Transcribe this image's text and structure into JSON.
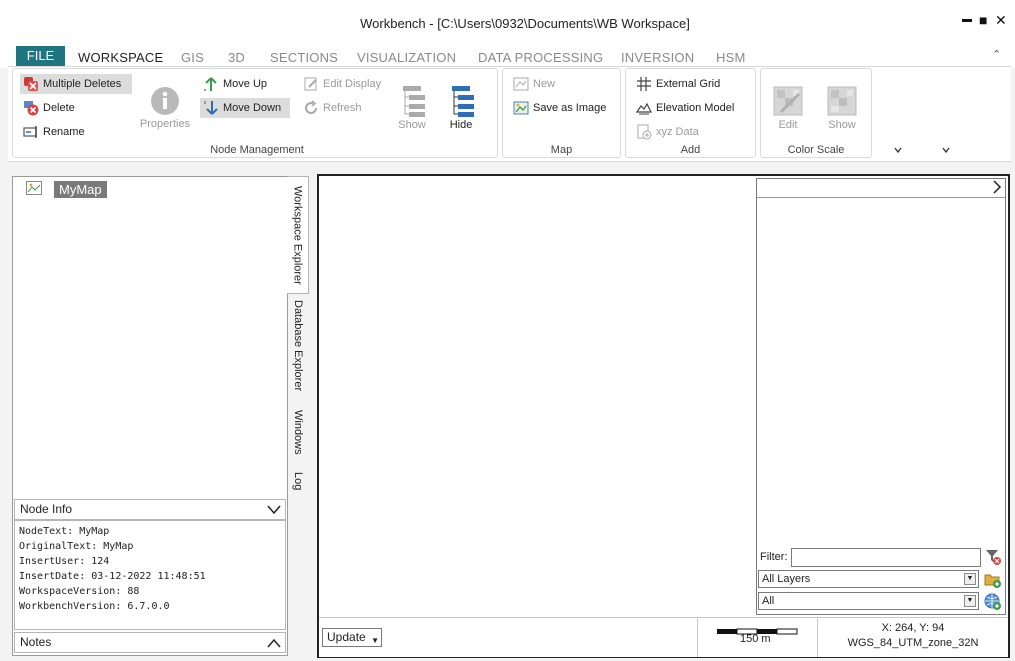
{
  "window": {
    "title": "Workbench - [C:\\Users\\0932\\Documents\\WB Workspace]"
  },
  "window_controls": {
    "minimize": "▬",
    "maximize": "■",
    "close": "✕"
  },
  "ribbon_tabs": {
    "file": "FILE",
    "workspace": "WORKSPACE",
    "gis": "GIS",
    "three_d": "3D",
    "sections": "SECTIONS",
    "visualization": "VISUALIZATION",
    "data_processing": "DATA PROCESSING",
    "inversion": "INVERSION",
    "hsm": "HSM",
    "collapse": "⌃"
  },
  "node_management": {
    "label": "Node Management",
    "multiple_deletes": "Multiple Deletes",
    "delete": "Delete",
    "rename": "Rename",
    "properties": "Properties",
    "move_up": "Move Up",
    "move_down": "Move Down",
    "edit_display": "Edit Display",
    "refresh": "Refresh",
    "show": "Show",
    "hide": "Hide"
  },
  "map_group": {
    "label": "Map",
    "new": "New",
    "save_as_image": "Save as Image"
  },
  "add_group": {
    "label": "Add",
    "external_grid": "External Grid",
    "elevation_model": "Elevation Model",
    "xyz_data": "xyz Data"
  },
  "color_scale_group": {
    "label": "Color Scale",
    "edit": "Edit",
    "show": "Show"
  },
  "tree": {
    "root_label": "MyMap"
  },
  "side_tabs": {
    "workspace_explorer": "Workspace Explorer",
    "database_explorer": "Database Explorer",
    "windows": "Windows",
    "log": "Log"
  },
  "node_info": {
    "header": "Node Info",
    "lines": [
      "NodeText:  MyMap",
      "OriginalText:  MyMap",
      "InsertUser:  124",
      "InsertDate:  03-12-2022 11:48:51",
      "WorkspaceVersion:  88",
      "WorkbenchVersion:  6.7.0.0"
    ]
  },
  "notes": {
    "header": "Notes"
  },
  "layers_panel": {
    "filter_label": "Filter:",
    "filter_value": "",
    "layer_select": "All Layers",
    "type_select": "All"
  },
  "statusbar": {
    "update": "Update",
    "scale": "150 m",
    "coords": "X: 264, Y: 94",
    "crs": "WGS_84_UTM_zone_32N"
  },
  "colors": {
    "file_tab": "#217580",
    "accent_blue": "#2f6db5",
    "green_arrow": "#3a9a4a"
  }
}
